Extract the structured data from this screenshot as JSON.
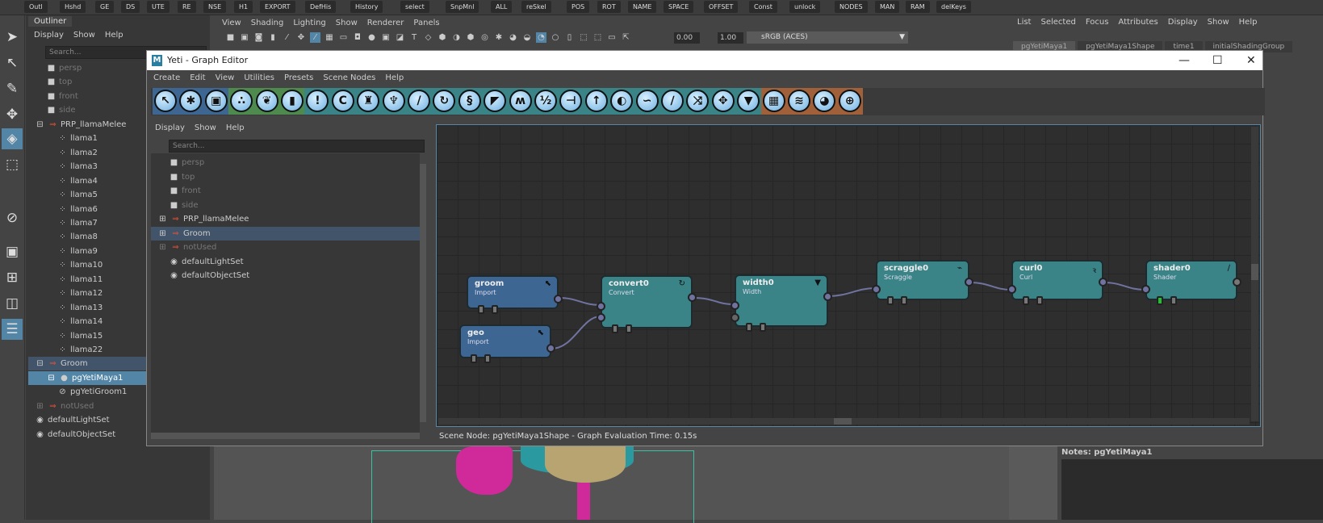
{
  "shelf": {
    "buttons": [
      "Outl",
      "Hshd",
      "GE",
      "DS",
      "UTE",
      "RE",
      "NSE",
      "H1",
      "EXPORT",
      "DefHis",
      "History",
      "select",
      "SnpMnl",
      "ALL",
      "reSkel",
      "POS",
      "ROT",
      "NAME",
      "SPACE",
      "OFFSET",
      "Const",
      "unlock",
      "NODES",
      "MAN",
      "RAM",
      "delKeys"
    ]
  },
  "outliner": {
    "tab": "Outliner",
    "menu": [
      "Display",
      "Show",
      "Help"
    ],
    "search_placeholder": "Search...",
    "items": [
      {
        "label": "persp",
        "icon": "camera-icon",
        "dim": true,
        "indent": 1
      },
      {
        "label": "top",
        "icon": "camera-icon",
        "dim": true,
        "indent": 1
      },
      {
        "label": "front",
        "icon": "camera-icon",
        "dim": true,
        "indent": 1
      },
      {
        "label": "side",
        "icon": "camera-icon",
        "dim": true,
        "indent": 1
      },
      {
        "label": "PRP_llamaMelee",
        "icon": "group-icon",
        "expand": "⊟",
        "indent": 0
      },
      {
        "label": "llama1",
        "icon": "transform-icon",
        "indent": 2
      },
      {
        "label": "llama2",
        "icon": "transform-icon",
        "indent": 2
      },
      {
        "label": "llama3",
        "icon": "transform-icon",
        "indent": 2
      },
      {
        "label": "llama4",
        "icon": "transform-icon",
        "indent": 2
      },
      {
        "label": "llama5",
        "icon": "transform-icon",
        "indent": 2
      },
      {
        "label": "llama6",
        "icon": "transform-icon",
        "indent": 2
      },
      {
        "label": "llama7",
        "icon": "transform-icon",
        "indent": 2
      },
      {
        "label": "llama8",
        "icon": "transform-icon",
        "indent": 2
      },
      {
        "label": "llama9",
        "icon": "transform-icon",
        "indent": 2
      },
      {
        "label": "llama10",
        "icon": "transform-icon",
        "indent": 2
      },
      {
        "label": "llama11",
        "icon": "transform-icon",
        "indent": 2
      },
      {
        "label": "llama12",
        "icon": "transform-icon",
        "indent": 2
      },
      {
        "label": "llama13",
        "icon": "transform-icon",
        "indent": 2
      },
      {
        "label": "llama14",
        "icon": "transform-icon",
        "indent": 2
      },
      {
        "label": "llama15",
        "icon": "transform-icon",
        "indent": 2
      },
      {
        "label": "llama22",
        "icon": "transform-icon",
        "indent": 2
      },
      {
        "label": "Groom",
        "icon": "group-icon",
        "expand": "⊟",
        "indent": 0,
        "state": "hl"
      },
      {
        "label": "pgYetiMaya1",
        "icon": "yeti-node-icon",
        "expand": "⊟",
        "indent": 1,
        "state": "sel"
      },
      {
        "label": "pgYetiGroom1",
        "icon": "groom-icon",
        "indent": 2
      },
      {
        "label": "notUsed",
        "icon": "group-icon",
        "expand": "⊞",
        "indent": 0,
        "dim": true
      },
      {
        "label": "defaultLightSet",
        "icon": "set-icon",
        "indent": 0
      },
      {
        "label": "defaultObjectSet",
        "icon": "set-icon",
        "indent": 0
      }
    ]
  },
  "viewport": {
    "menu": [
      "View",
      "Shading",
      "Lighting",
      "Show",
      "Renderer",
      "Panels"
    ],
    "exposure": "0.00",
    "gamma": "1.00",
    "colorspace": "sRGB (ACES)"
  },
  "attr": {
    "menu": [
      "List",
      "Selected",
      "Focus",
      "Attributes",
      "Display",
      "Show",
      "Help"
    ],
    "tabs": [
      "pgYetiMaya1",
      "pgYetiMaya1Shape",
      "time1",
      "initialShadingGroup"
    ],
    "notes": "Notes:  pgYetiMaya1"
  },
  "graph": {
    "title": "Yeti - Graph Editor",
    "menu": [
      "Create",
      "Edit",
      "View",
      "Utilities",
      "Presets",
      "Scene Nodes",
      "Help"
    ],
    "toolbar": [
      {
        "icon": "import-icon",
        "g": "#3e6692",
        "glyph": "↖"
      },
      {
        "icon": "scatter-icon",
        "g": "#3e6692",
        "glyph": "✱"
      },
      {
        "icon": "box-icon",
        "g": "#3e6692",
        "glyph": "▣"
      },
      {
        "icon": "face-icon",
        "g": "#4e8a4e",
        "glyph": "∴"
      },
      {
        "icon": "leaf-icon",
        "g": "#4e8a4e",
        "glyph": "❦"
      },
      {
        "icon": "bucket-icon",
        "g": "#4e8a4e",
        "glyph": "▮"
      },
      {
        "icon": "exclamation-icon",
        "g": "#3a8387",
        "glyph": "!"
      },
      {
        "icon": "clump-icon",
        "g": "#3a8387",
        "glyph": "C"
      },
      {
        "icon": "lamp-icon",
        "g": "#3a8387",
        "glyph": "♜"
      },
      {
        "icon": "bat-icon",
        "g": "#3a8387",
        "glyph": "♆"
      },
      {
        "icon": "comb-icon",
        "g": "#3a8387",
        "glyph": "/"
      },
      {
        "icon": "curl-icon",
        "g": "#3a8387",
        "glyph": "↻"
      },
      {
        "icon": "squiggle-icon",
        "g": "#3a8387",
        "glyph": "§"
      },
      {
        "icon": "brush-icon",
        "g": "#3a8387",
        "glyph": "◤"
      },
      {
        "icon": "noise-icon",
        "g": "#3a8387",
        "glyph": "ʍ"
      },
      {
        "icon": "split-icon",
        "g": "#3a8387",
        "glyph": "½"
      },
      {
        "icon": "sign-icon",
        "g": "#3a8387",
        "glyph": "⊣"
      },
      {
        "icon": "arrow-up-icon",
        "g": "#3a8387",
        "glyph": "↑"
      },
      {
        "icon": "circle-icon",
        "g": "#3a8387",
        "glyph": "◐"
      },
      {
        "icon": "scraggle-icon",
        "g": "#3a8387",
        "glyph": "∽"
      },
      {
        "icon": "shader-icon",
        "g": "#3a8387",
        "glyph": "∕"
      },
      {
        "icon": "random-icon",
        "g": "#3a8387",
        "glyph": "⤨"
      },
      {
        "icon": "move-icon",
        "g": "#3a8387",
        "glyph": "✥"
      },
      {
        "icon": "width-icon",
        "g": "#3a8387",
        "glyph": "▼"
      },
      {
        "icon": "grid-icon",
        "g": "#a0603a",
        "glyph": "▦"
      },
      {
        "icon": "wave-icon",
        "g": "#a0603a",
        "glyph": "≋"
      },
      {
        "icon": "palette-icon",
        "g": "#a0603a",
        "glyph": "◕"
      },
      {
        "icon": "globe-icon",
        "g": "#a0603a",
        "glyph": "⊕"
      }
    ],
    "side_menu": [
      "Display",
      "Show",
      "Help"
    ],
    "search_placeholder": "Search...",
    "scene_items": [
      {
        "label": "persp",
        "icon": "camera-icon",
        "dim": true
      },
      {
        "label": "top",
        "icon": "camera-icon",
        "dim": true
      },
      {
        "label": "front",
        "icon": "camera-icon",
        "dim": true
      },
      {
        "label": "side",
        "icon": "camera-icon",
        "dim": true
      },
      {
        "label": "PRP_llamaMelee",
        "icon": "group-icon",
        "expand": "⊞"
      },
      {
        "label": "Groom",
        "icon": "group-icon",
        "expand": "⊞",
        "state": "hl"
      },
      {
        "label": "notUsed",
        "icon": "group-icon",
        "expand": "⊞",
        "dim": true
      },
      {
        "label": "defaultLightSet",
        "icon": "set-icon"
      },
      {
        "label": "defaultObjectSet",
        "icon": "set-icon"
      }
    ],
    "nodes": [
      {
        "name": "groom",
        "type": "Import",
        "icon": "import-icon",
        "glyph": "⬉",
        "color": "blue"
      },
      {
        "name": "geo",
        "type": "Import",
        "icon": "import-icon",
        "glyph": "⬉",
        "color": "blue"
      },
      {
        "name": "convert0",
        "type": "Convert",
        "icon": "convert-icon",
        "glyph": "↻",
        "color": "teal"
      },
      {
        "name": "width0",
        "type": "Width",
        "icon": "width-icon",
        "glyph": "▼",
        "color": "teal"
      },
      {
        "name": "scraggle0",
        "type": "Scraggle",
        "icon": "scraggle-icon",
        "glyph": "⌁",
        "color": "teal"
      },
      {
        "name": "curl0",
        "type": "Curl",
        "icon": "curl-icon",
        "glyph": "ꝛ",
        "color": "teal"
      },
      {
        "name": "shader0",
        "type": "Shader",
        "icon": "shader-icon",
        "glyph": "∕",
        "color": "teal"
      }
    ],
    "status": "Scene Node: pgYetiMaya1Shape - Graph Evaluation Time: 0.15s"
  }
}
